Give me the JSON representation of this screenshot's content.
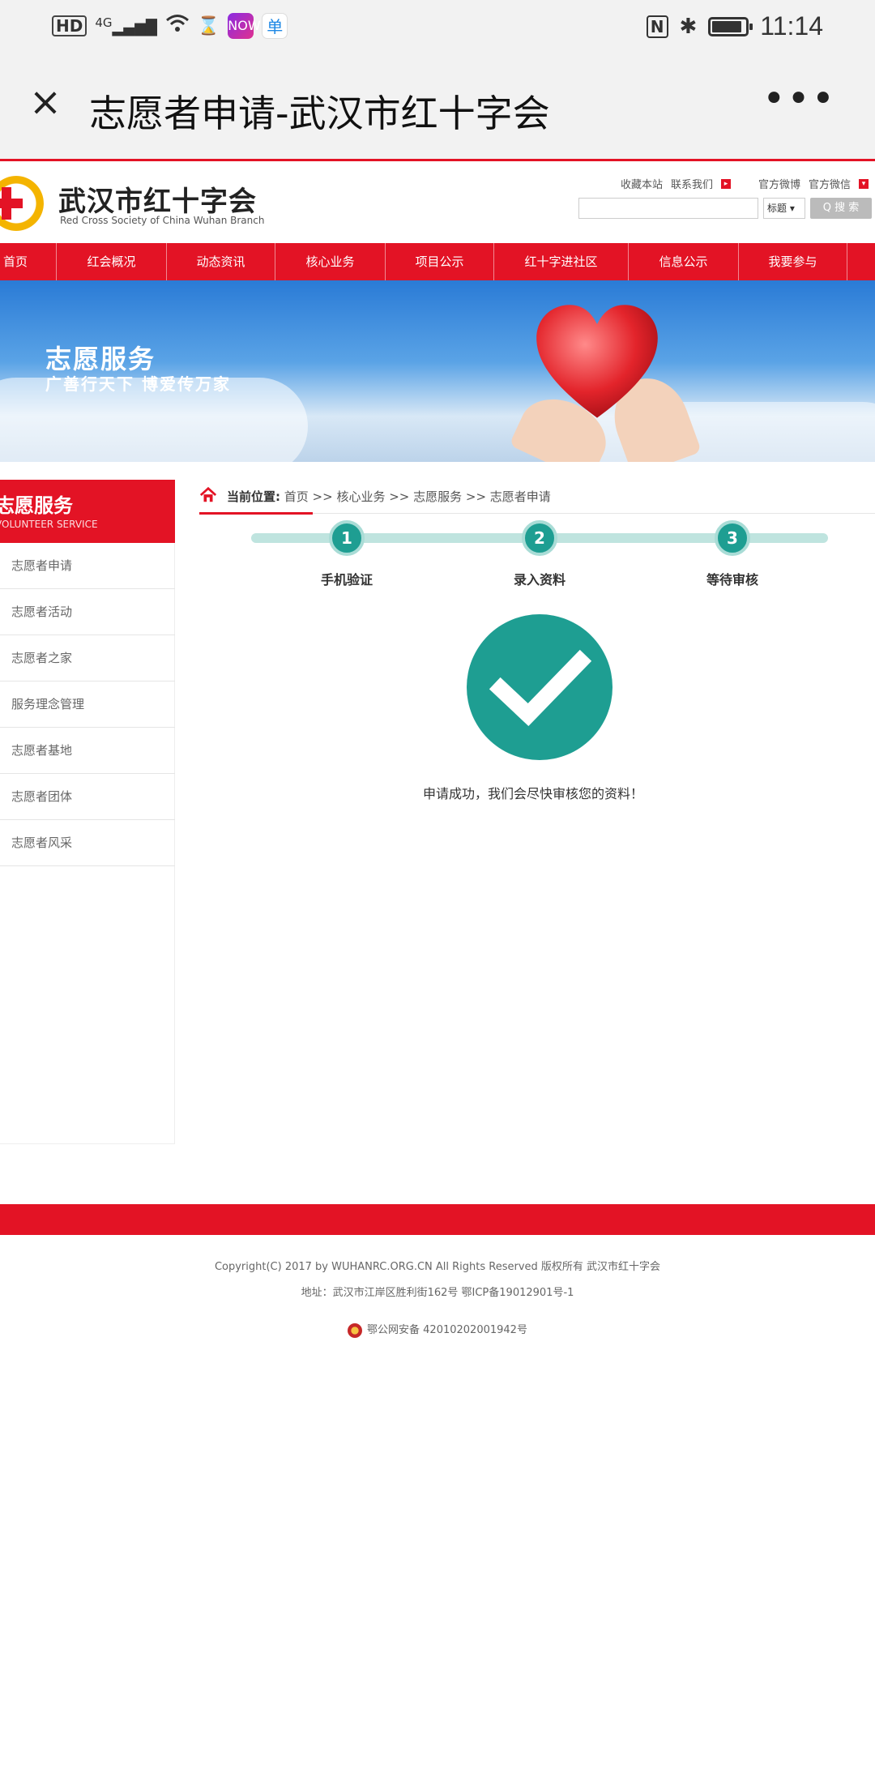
{
  "status_bar": {
    "hd": "HD",
    "network": "4G",
    "app1_label": "NOW",
    "app2_label": "单",
    "nfc": "N",
    "bluetooth": "✱",
    "time": "11:14"
  },
  "navbar": {
    "close_glyph": "×",
    "title": "志愿者申请-武汉市红十字会",
    "more_glyph": "•••"
  },
  "site": {
    "logo_cn": "武汉市红十字会",
    "logo_en": "Red Cross Society of China Wuhan Branch",
    "top_links": [
      "收藏本站",
      "联系我们",
      "官方微博",
      "官方微信"
    ],
    "search_select": "标题 ▾",
    "search_button": "Q 搜 索",
    "nav": [
      "首页",
      "红会概况",
      "动态资讯",
      "核心业务",
      "项目公示",
      "红十字进社区",
      "信息公示",
      "我要参与"
    ]
  },
  "banner": {
    "title": "志愿服务",
    "subtitle": "广善行天下  博爱传万家"
  },
  "sidebar": {
    "title": "志愿服务",
    "subtitle": "VOLUNTEER SERVICE",
    "items": [
      "志愿者申请",
      "志愿者活动",
      "志愿者之家",
      "服务理念管理",
      "志愿者基地",
      "志愿者团体",
      "志愿者风采"
    ]
  },
  "content": {
    "breadcrumb_label": "当前位置:",
    "breadcrumb_path": " 首页 >> 核心业务 >> 志愿服务 >> 志愿者申请",
    "steps": [
      {
        "num": "1",
        "label": "手机验证"
      },
      {
        "num": "2",
        "label": "录入资料"
      },
      {
        "num": "3",
        "label": "等待审核"
      }
    ],
    "success_message": "申请成功，我们会尽快审核您的资料！"
  },
  "footer": {
    "copyright": "Copyright(C) 2017 by WUHANRC.ORG.CN All Rights Reserved    版权所有 武汉市红十字会",
    "address": "地址：武汉市江岸区胜利街162号 鄂ICP备19012901号-1",
    "police": "鄂公网安备 42010202001942号"
  },
  "colors": {
    "brand_red": "#e31325",
    "step_teal": "#1e9e92"
  }
}
